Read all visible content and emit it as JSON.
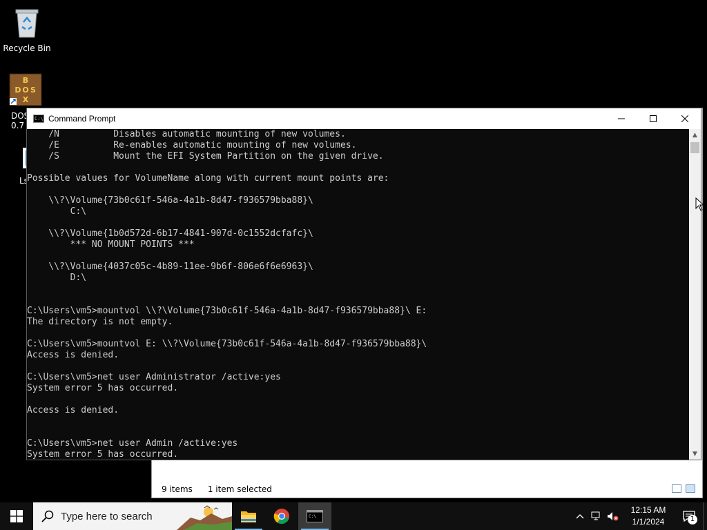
{
  "desktop": {
    "icons": [
      {
        "label": "Recycle Bin"
      },
      {
        "label": "DOS\n0.7"
      },
      {
        "label": "Ls"
      }
    ]
  },
  "explorer": {
    "status_items": "9 items",
    "status_selected": "1 item selected"
  },
  "cmd": {
    "title": "Command Prompt",
    "icon_text": "C:\\_",
    "lines": [
      "    /N          Disables automatic mounting of new volumes.",
      "    /E          Re-enables automatic mounting of new volumes.",
      "    /S          Mount the EFI System Partition on the given drive.",
      "",
      "Possible values for VolumeName along with current mount points are:",
      "",
      "    \\\\?\\Volume{73b0c61f-546a-4a1b-8d47-f936579bba88}\\",
      "        C:\\",
      "",
      "    \\\\?\\Volume{1b0d572d-6b17-4841-907d-0c1552dcfafc}\\",
      "        *** NO MOUNT POINTS ***",
      "",
      "    \\\\?\\Volume{4037c05c-4b89-11ee-9b6f-806e6f6e6963}\\",
      "        D:\\",
      "",
      "",
      "C:\\Users\\vm5>mountvol \\\\?\\Volume{73b0c61f-546a-4a1b-8d47-f936579bba88}\\ E:",
      "The directory is not empty.",
      "",
      "C:\\Users\\vm5>mountvol E: \\\\?\\Volume{73b0c61f-546a-4a1b-8d47-f936579bba88}\\",
      "Access is denied.",
      "",
      "C:\\Users\\vm5>net user Administrator /active:yes",
      "System error 5 has occurred.",
      "",
      "Access is denied.",
      "",
      "",
      "C:\\Users\\vm5>net user Admin /active:yes",
      "System error 5 has occurred."
    ]
  },
  "taskbar": {
    "search_placeholder": "Type here to search",
    "time": "12:15 AM",
    "date": "1/1/2024",
    "notification_count": "1"
  }
}
